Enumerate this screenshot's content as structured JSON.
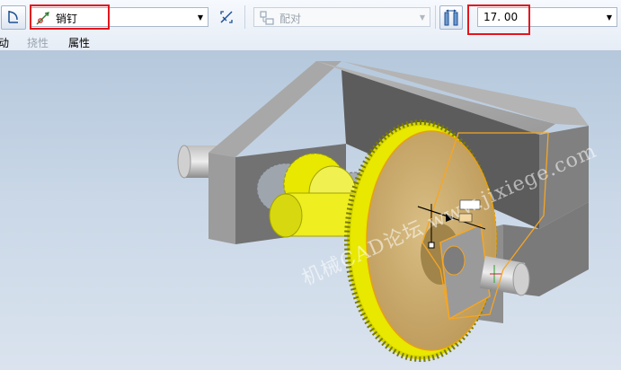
{
  "toolbar": {
    "connection_type": {
      "icon": "pin-joint-icon",
      "value": "销钉"
    },
    "constraint_type": {
      "icon": "align-icon",
      "value": "配对"
    },
    "offset": {
      "icon": "offset-icon",
      "value": "17. 00"
    }
  },
  "tabs": [
    {
      "label": "动"
    },
    {
      "label": "挠性"
    },
    {
      "label": "属性"
    }
  ],
  "viewport": {
    "watermark": "机械CAD论坛 www.jixiege.com",
    "colors": {
      "gear": "#e8e800",
      "gear_face": "#c9a860",
      "frame": "#8c8c8c",
      "selection": "#f5a623",
      "background": "#c9d7e7"
    }
  },
  "highlights": {
    "color": "#e2151e"
  }
}
